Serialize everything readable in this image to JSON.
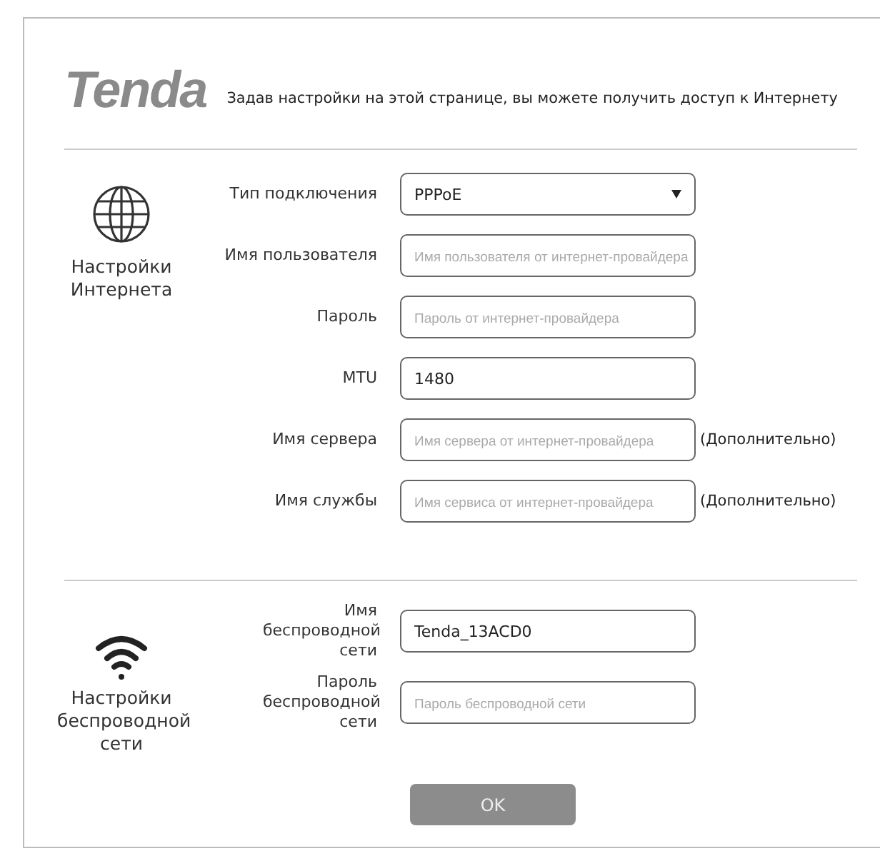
{
  "header": {
    "logo": "Tenda",
    "description": "Задав настройки на этой странице, вы можете получить доступ к Интернету"
  },
  "sections": [
    {
      "kind": "internet",
      "title": "Настройки Интернета",
      "fields": [
        {
          "kind": "select",
          "label": "Тип подключения",
          "value": "PPPoE"
        },
        {
          "kind": "input",
          "label": "Имя пользователя",
          "placeholder": "Имя пользователя от интернет-провайдера"
        },
        {
          "kind": "input",
          "label": "Пароль",
          "placeholder": "Пароль от интернет-провайдера"
        },
        {
          "kind": "input",
          "label": "MTU",
          "value": "1480"
        },
        {
          "kind": "input",
          "label": "Имя сервера",
          "placeholder": "Имя сервера от интернет-провайдера",
          "note": "(Дополнительно)"
        },
        {
          "kind": "input",
          "label": "Имя службы",
          "placeholder": "Имя сервиса от интернет-провайдера",
          "note": "(Дополнительно)"
        }
      ]
    },
    {
      "kind": "wireless",
      "title": "Настройки беспроводной сети",
      "fields": [
        {
          "kind": "input",
          "label": "Имя беспроводной сети",
          "value": "Tenda_13ACD0"
        },
        {
          "kind": "input",
          "label": "Пароль беспроводной сети",
          "placeholder": "Пароль беспроводной сети"
        }
      ]
    }
  ],
  "ok_button": {
    "label": "OK"
  }
}
